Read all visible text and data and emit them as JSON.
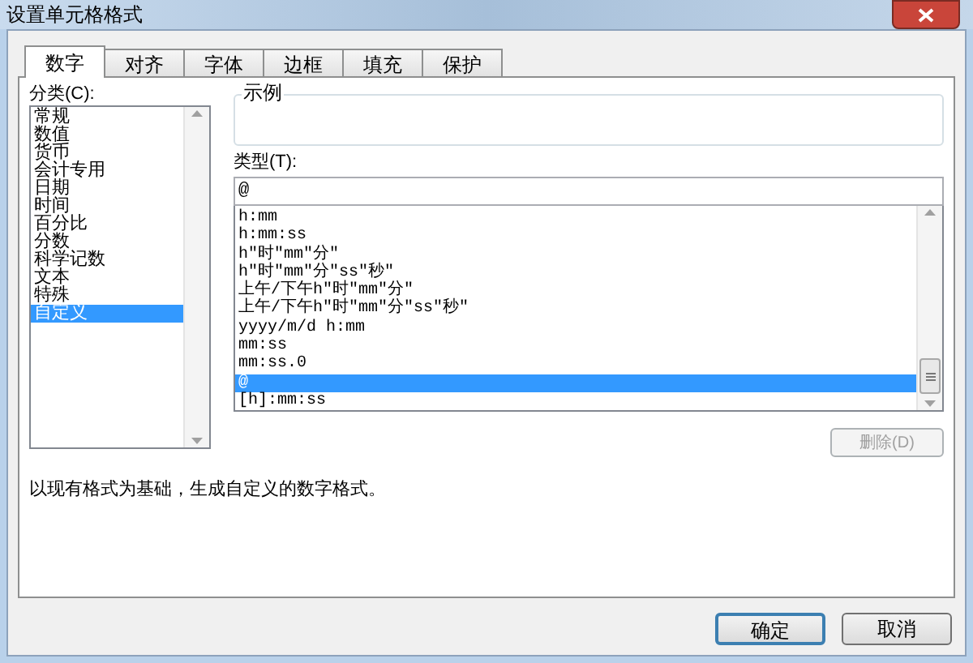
{
  "window": {
    "title": "设置单元格格式"
  },
  "tabs": [
    {
      "label": "数字",
      "selected": true
    },
    {
      "label": "对齐",
      "selected": false
    },
    {
      "label": "字体",
      "selected": false
    },
    {
      "label": "边框",
      "selected": false
    },
    {
      "label": "填充",
      "selected": false
    },
    {
      "label": "保护",
      "selected": false
    }
  ],
  "category": {
    "label": "分类(C):",
    "items": [
      {
        "label": "常规",
        "selected": false
      },
      {
        "label": "数值",
        "selected": false
      },
      {
        "label": "货币",
        "selected": false
      },
      {
        "label": "会计专用",
        "selected": false
      },
      {
        "label": "日期",
        "selected": false
      },
      {
        "label": "时间",
        "selected": false
      },
      {
        "label": "百分比",
        "selected": false
      },
      {
        "label": "分数",
        "selected": false
      },
      {
        "label": "科学记数",
        "selected": false
      },
      {
        "label": "文本",
        "selected": false
      },
      {
        "label": "特殊",
        "selected": false
      },
      {
        "label": "自定义",
        "selected": true
      }
    ]
  },
  "sample": {
    "label": "示例"
  },
  "type": {
    "label": "类型(T):",
    "value": "@",
    "items": [
      {
        "label": "h:mm",
        "selected": false
      },
      {
        "label": "h:mm:ss",
        "selected": false
      },
      {
        "label": "h\"时\"mm\"分\"",
        "selected": false
      },
      {
        "label": "h\"时\"mm\"分\"ss\"秒\"",
        "selected": false
      },
      {
        "label": "上午/下午h\"时\"mm\"分\"",
        "selected": false
      },
      {
        "label": "上午/下午h\"时\"mm\"分\"ss\"秒\"",
        "selected": false
      },
      {
        "label": "yyyy/m/d h:mm",
        "selected": false
      },
      {
        "label": "mm:ss",
        "selected": false
      },
      {
        "label": "mm:ss.0",
        "selected": false
      },
      {
        "label": "@",
        "selected": true
      },
      {
        "label": "[h]:mm:ss",
        "selected": false
      }
    ]
  },
  "delete_button": {
    "label": "删除(D)",
    "disabled": true
  },
  "description": "以现有格式为基础，生成自定义的数字格式。",
  "buttons": [
    {
      "label": "确定",
      "default": true
    },
    {
      "label": "取消",
      "default": false
    }
  ]
}
